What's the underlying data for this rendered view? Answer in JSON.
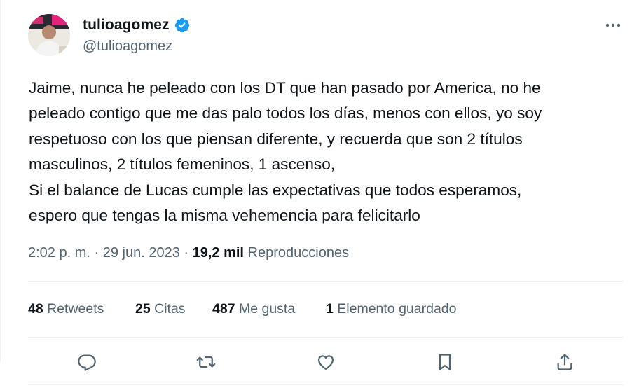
{
  "user": {
    "display_name": "tulioagomez",
    "handle": "@tulioagomez",
    "verified": true,
    "verified_color": "#1d9bf0"
  },
  "tweet": {
    "lines": [
      "Jaime, nunca he peleado con los DT que han pasado por America, no he",
      "peleado contigo que me das palo todos los días, menos con ellos, yo soy",
      "respetuoso con los que piensan diferente, y recuerda que son 2 títulos",
      "masculinos, 2 títulos femeninos, 1 ascenso,",
      "Si el balance de Lucas cumple las expectativas que todos esperamos,",
      "espero que tengas la misma vehemencia para felicitarlo"
    ]
  },
  "meta": {
    "time": "2:02 p. m.",
    "sep1": " · ",
    "date": "29 jun. 2023",
    "sep2": " · ",
    "views": "19,2 mil",
    "views_label": " Reproducciones"
  },
  "stats": {
    "retweets_count": "48",
    "retweets_label": " Retweets",
    "quotes_count": "25",
    "quotes_label": " Citas",
    "likes_count": "487",
    "likes_label": " Me gusta",
    "bookmarks_count": "1",
    "bookmarks_label": " Elemento guardado"
  },
  "actions": [
    "reply-icon",
    "retweet-icon",
    "like-icon",
    "bookmark-icon",
    "share-icon"
  ],
  "colors": {
    "text": "#0f1419",
    "secondary": "#536471",
    "border": "#eff3f4"
  }
}
